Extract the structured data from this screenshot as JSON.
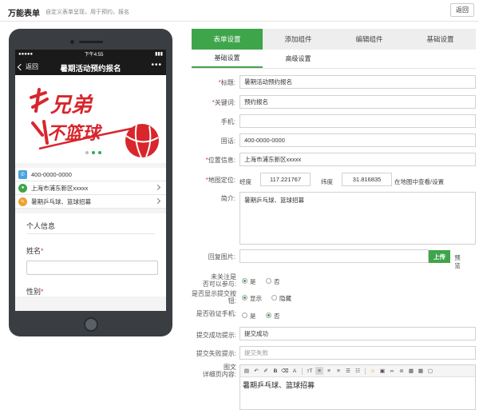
{
  "header": {
    "title": "万能表单",
    "subtitle": "自定义表单呈现，用于预约，报名",
    "back_label": "返回"
  },
  "phone": {
    "status_left": "●●●●●",
    "status_time": "下午4:55",
    "status_right": "▮▮▮",
    "nav_back": "返回",
    "nav_title": "暑期活动预约报名",
    "nav_more": "•••",
    "banner_text_1": "兄弟",
    "banner_text_2": "不篮球",
    "info_rows": [
      {
        "icon": "phone-icon",
        "text": "400-0000-0000",
        "color": "#4aa3df"
      },
      {
        "icon": "location-icon",
        "text": "上海市浦东新区xxxxx",
        "color": "#3fa54b"
      },
      {
        "icon": "pencil-icon",
        "text": "暑期乒乓球、篮球招募",
        "color": "#f0a030"
      }
    ],
    "section_title": "个人信息",
    "field_name": "姓名",
    "field_gender": "性别",
    "required_mark": "*"
  },
  "tabs": [
    {
      "label": "表单设置",
      "active": true
    },
    {
      "label": "添加组件",
      "active": false
    },
    {
      "label": "编辑组件",
      "active": false
    },
    {
      "label": "基础设置",
      "active": false
    }
  ],
  "subtabs": [
    {
      "label": "基础设置",
      "active": true
    },
    {
      "label": "高级设置",
      "active": false
    }
  ],
  "form": {
    "title_label": "标题:",
    "title_value": "暑期活动预约报名",
    "keyword_label": "关键词:",
    "keyword_value": "预约报名",
    "mobile_label": "手机:",
    "mobile_value": "",
    "phone_label": "固话:",
    "phone_value": "400-0000-0000",
    "location_label": "位置信息:",
    "location_value": "上海市浦东新区xxxxx",
    "map_label": "地图定位:",
    "lng_label": "经度",
    "lng_value": "117.221767",
    "lat_label": "纬度",
    "lat_value": "31.816835",
    "map_link": "在地图中查看/设置",
    "intro_label": "简介:",
    "intro_value": "暑期乒乓球、篮球招募",
    "reply_img_label": "回复图片:",
    "upload_label": "上传",
    "preview_label": "预览",
    "follow_label_1": "未关注是",
    "follow_label_2": "否可以参与:",
    "show_submit_label_1": "是否显示提交按",
    "show_submit_label_2": "钮:",
    "verify_label": "是否验证手机:",
    "yes": "是",
    "no": "否",
    "show": "显示",
    "hide": "隐藏",
    "success_label": "提交成功提示:",
    "success_value": "提交成功",
    "fail_label": "提交失败提示:",
    "fail_value": "提交失败",
    "detail_label_1": "图文",
    "detail_label_2": "详细页内容:",
    "editor_content": "暑期乒乓球、篮球招募",
    "required_mark": "*"
  }
}
